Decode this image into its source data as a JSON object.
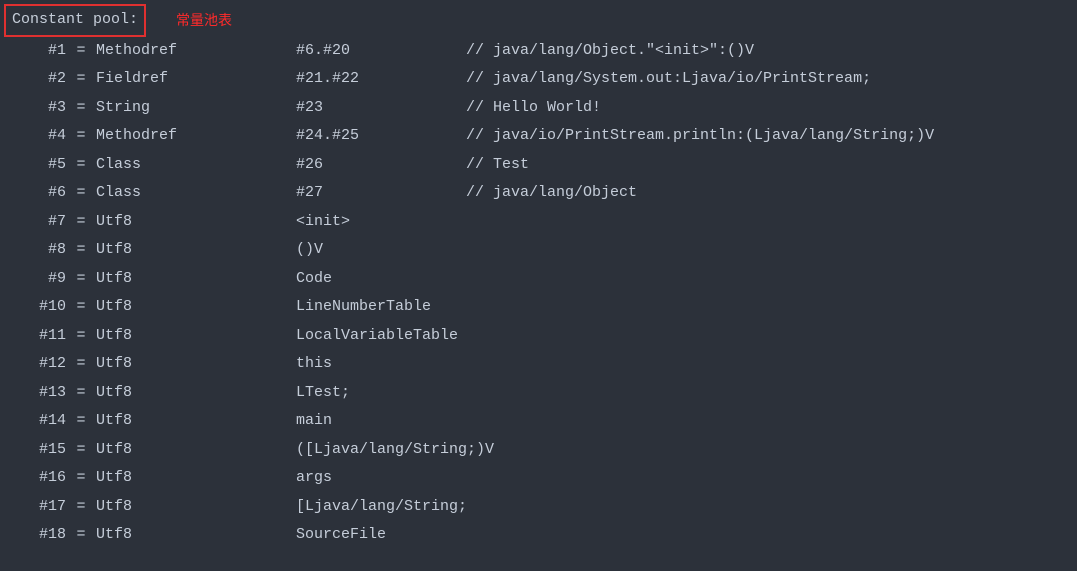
{
  "header": {
    "title": "Constant pool:",
    "annotation": "常量池表"
  },
  "rows": [
    {
      "idx": "#1",
      "kind": "Methodref",
      "value": "#6.#20",
      "comment": "// java/lang/Object.\"<init>\":()V"
    },
    {
      "idx": "#2",
      "kind": "Fieldref",
      "value": "#21.#22",
      "comment": "// java/lang/System.out:Ljava/io/PrintStream;"
    },
    {
      "idx": "#3",
      "kind": "String",
      "value": "#23",
      "comment": "// Hello World!"
    },
    {
      "idx": "#4",
      "kind": "Methodref",
      "value": "#24.#25",
      "comment": "// java/io/PrintStream.println:(Ljava/lang/String;)V"
    },
    {
      "idx": "#5",
      "kind": "Class",
      "value": "#26",
      "comment": "// Test"
    },
    {
      "idx": "#6",
      "kind": "Class",
      "value": "#27",
      "comment": "// java/lang/Object"
    },
    {
      "idx": "#7",
      "kind": "Utf8",
      "value": "<init>",
      "comment": ""
    },
    {
      "idx": "#8",
      "kind": "Utf8",
      "value": "()V",
      "comment": ""
    },
    {
      "idx": "#9",
      "kind": "Utf8",
      "value": "Code",
      "comment": ""
    },
    {
      "idx": "#10",
      "kind": "Utf8",
      "value": "LineNumberTable",
      "comment": ""
    },
    {
      "idx": "#11",
      "kind": "Utf8",
      "value": "LocalVariableTable",
      "comment": ""
    },
    {
      "idx": "#12",
      "kind": "Utf8",
      "value": "this",
      "comment": ""
    },
    {
      "idx": "#13",
      "kind": "Utf8",
      "value": "LTest;",
      "comment": ""
    },
    {
      "idx": "#14",
      "kind": "Utf8",
      "value": "main",
      "comment": ""
    },
    {
      "idx": "#15",
      "kind": "Utf8",
      "value": "([Ljava/lang/String;)V",
      "comment": ""
    },
    {
      "idx": "#16",
      "kind": "Utf8",
      "value": "args",
      "comment": ""
    },
    {
      "idx": "#17",
      "kind": "Utf8",
      "value": "[Ljava/lang/String;",
      "comment": ""
    },
    {
      "idx": "#18",
      "kind": "Utf8",
      "value": "SourceFile",
      "comment": ""
    }
  ]
}
